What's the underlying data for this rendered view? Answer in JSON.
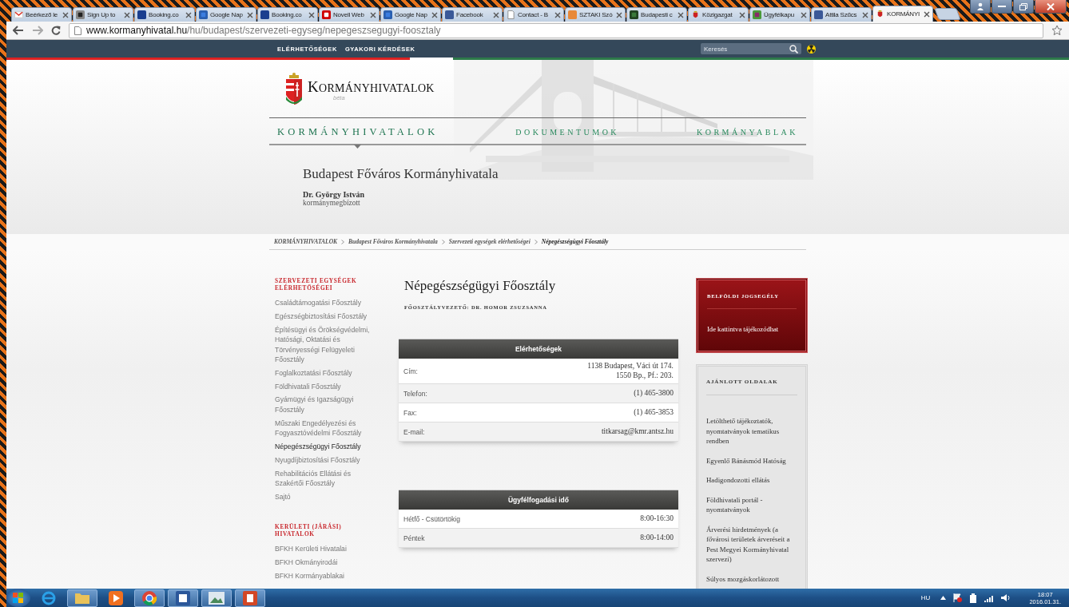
{
  "browser": {
    "tabs": [
      {
        "title": "Beérkező le",
        "kind": "mail",
        "selected": false
      },
      {
        "title": "Sign Up to",
        "kind": "app",
        "selected": false
      },
      {
        "title": "Booking.co",
        "kind": "booking",
        "selected": false
      },
      {
        "title": "Google Nap",
        "kind": "calendar",
        "selected": false
      },
      {
        "title": "Booking.co",
        "kind": "booking",
        "selected": false
      },
      {
        "title": "Novell Web",
        "kind": "novell",
        "selected": false
      },
      {
        "title": "Google Nap",
        "kind": "calendar",
        "selected": false
      },
      {
        "title": "Facebook",
        "kind": "facebook",
        "selected": false
      },
      {
        "title": "Contact - B",
        "kind": "page",
        "selected": false
      },
      {
        "title": "SZTAKI Szó",
        "kind": "sztaki",
        "selected": false
      },
      {
        "title": "Budapesti c",
        "kind": "book",
        "selected": false
      },
      {
        "title": "Közigazgat",
        "kind": "crest",
        "selected": false
      },
      {
        "title": "Ügyfélkapu",
        "kind": "kapu",
        "selected": false
      },
      {
        "title": "Attila Szűcs",
        "kind": "facebook",
        "selected": false
      },
      {
        "title": "KORMÁNYI",
        "kind": "crest",
        "selected": true
      }
    ],
    "url": {
      "host": "www.kormanyhivatal.hu",
      "path": "/hu/budapest/szervezeti-egyseg/nepegeszsegugyi-foosztaly"
    }
  },
  "top_nav": {
    "links": [
      "ELÉRHETŐSÉGEK",
      "GYAKORI KÉRDÉSEK"
    ],
    "search": {
      "placeholder": "Keresés"
    }
  },
  "logo": {
    "name": "KORMÁNYHIVATALOK",
    "tag": "béta"
  },
  "main_nav": [
    {
      "label": "KORMÁNYHIVATALOK",
      "selected": true
    },
    {
      "label": "DOKUMENTUMOK",
      "selected": false
    },
    {
      "label": "KORMÁNYABLAK",
      "selected": false
    }
  ],
  "office": {
    "title": "Budapest Főváros Kormányhivatala",
    "head_name": "Dr. György István",
    "head_role": "kormánymegbízott"
  },
  "breadcrumbs": [
    "KORMÁNYHIVATALOK",
    "Budapest Főváros Kormányhivatala",
    "Szervezeti egységek elérhetőségei",
    "Népegészségügyi Főosztály"
  ],
  "sidebar": [
    {
      "heading": "SZERVEZETI EGYSÉGEK ELÉRHETŐSÉGEI",
      "items": [
        {
          "label": "Családtámogatási Főosztály",
          "selected": false
        },
        {
          "label": "Egészségbiztosítási Főosztály",
          "selected": false
        },
        {
          "label": "Építésügyi és Örökségvédelmi, Hatósági, Oktatási és Törvényességi Felügyeleti Főosztály",
          "selected": false
        },
        {
          "label": "Foglalkoztatási Főosztály",
          "selected": false
        },
        {
          "label": "Földhivatali Főosztály",
          "selected": false
        },
        {
          "label": "Gyámügyi és Igazságügyi Főosztály",
          "selected": false
        },
        {
          "label": "Műszaki Engedélyezési és Fogyasztóvédelmi Főosztály",
          "selected": false
        },
        {
          "label": "Népegészségügyi Főosztály",
          "selected": true
        },
        {
          "label": "Nyugdíjbiztosítási Főosztály",
          "selected": false
        },
        {
          "label": "Rehabilitációs Ellátási és Szakértői Főosztály",
          "selected": false
        },
        {
          "label": "Sajtó",
          "selected": false
        }
      ]
    },
    {
      "heading": "KERÜLETI (JÁRÁSI) HIVATALOK",
      "items": [
        {
          "label": "BFKH Kerületi Hivatalai",
          "selected": false
        },
        {
          "label": "BFKH Okmányirodái",
          "selected": false
        },
        {
          "label": "BFKH Kormányablakai",
          "selected": false
        }
      ]
    }
  ],
  "content": {
    "title": "Népegészségügyi Főosztály",
    "head_line": "FŐOSZTÁLYVEZETŐ: DR. HOMOR ZSUZSANNA",
    "tables": [
      {
        "heading": "Elérhetőségek",
        "rows": [
          {
            "label": "Cím:",
            "value": [
              "1138 Budapest, Váci út 174.",
              "1550 Bp., Pf.: 203."
            ]
          },
          {
            "label": "Telefon:",
            "value": [
              "(1) 465-3800"
            ]
          },
          {
            "label": "Fax:",
            "value": [
              "(1) 465-3853"
            ]
          },
          {
            "label": "E-mail:",
            "value": [
              "titkarsag@kmr.antsz.hu"
            ]
          }
        ]
      },
      {
        "heading": "Ügyfélfogadási idő",
        "rows": [
          {
            "label": "Hétfő - Csütörtökig",
            "value": [
              "8:00-16:30"
            ]
          },
          {
            "label": "Péntek",
            "value": [
              "8:00-14:00"
            ]
          }
        ]
      }
    ]
  },
  "promo": {
    "title": "BELFÖLDI JOGSEGÉLY",
    "link": "Ide kattintva tájékozódhat"
  },
  "recommended": {
    "heading": "AJÁNLOTT OLDALAK",
    "links": [
      "Letölthető tájékoztatók, nyomtatványok tematikus rendben",
      "Egyenlő Bánásmód Hatóság",
      "Hadigondozotti ellátás",
      "Földhivatali portál - nyomtatványok",
      "Árverési hirdetmények (a fővárosi területek árveréseit a Pest Megyei Kormányhivatal szervezi)",
      "Súlyos mozgáskorlátozott"
    ]
  },
  "taskbar": {
    "language": "HU",
    "time": "18:07",
    "date": "2016.01.31."
  }
}
